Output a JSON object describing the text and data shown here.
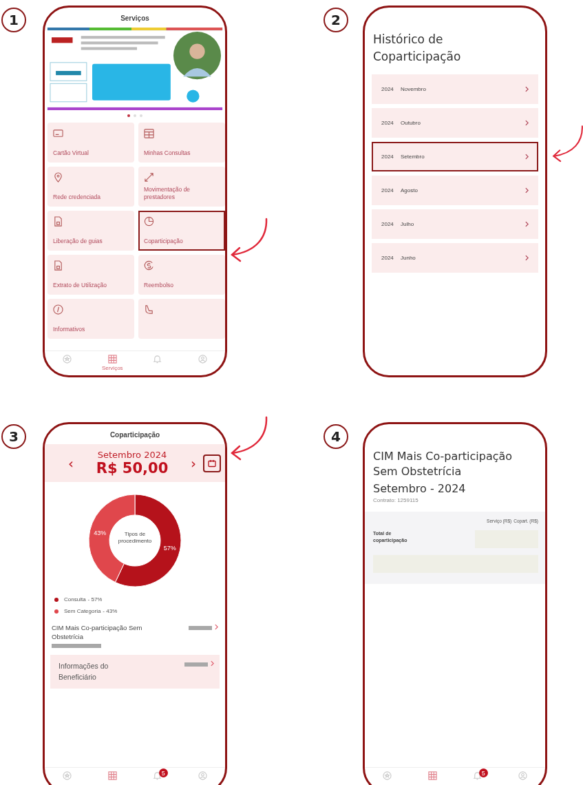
{
  "steps": [
    {
      "number": "1",
      "kind": "services",
      "arrow": true,
      "screen": {
        "title": "Serviços",
        "carousel": [
          {
            "selected": true
          },
          {
            "selected": false
          },
          {
            "selected": false
          }
        ],
        "tiles_left": [
          {
            "label": "Cartão Virtual",
            "highlighted": false
          },
          {
            "label": "Rede credenciada",
            "highlighted": false
          },
          {
            "label": "Liberação de guias",
            "highlighted": false
          },
          {
            "label": "Extrato de Utilização",
            "highlighted": false
          },
          {
            "label": "Informativos",
            "highlighted": false
          }
        ],
        "tiles_right": [
          {
            "label": "Minhas Consultas",
            "highlighted": false
          },
          {
            "label": "Movimentação de prestadores",
            "highlighted": false
          },
          {
            "label": "Coparticipação",
            "highlighted": true
          },
          {
            "label": "Reembolso",
            "highlighted": false
          },
          {
            "highlighted": false
          }
        ],
        "tab_bar": [
          {
            "selected": false
          },
          {
            "label": "Serviços",
            "selected": true
          },
          {
            "selected": false
          },
          {
            "selected": false
          }
        ]
      }
    },
    {
      "number": "2",
      "kind": "history",
      "arrow": true,
      "screen": {
        "title": "Histórico de Coparticipação",
        "months": [
          {
            "year": "2024",
            "month": "Novembro",
            "highlighted": false
          },
          {
            "year": "2024",
            "month": "Outubro",
            "highlighted": false
          },
          {
            "year": "2024",
            "month": "Setembro",
            "highlighted": true
          },
          {
            "year": "2024",
            "month": "Agosto",
            "highlighted": false
          },
          {
            "year": "2024",
            "month": "Julho",
            "highlighted": false
          },
          {
            "year": "2024",
            "month": "Junho",
            "highlighted": false
          }
        ]
      }
    },
    {
      "number": "3",
      "kind": "summary",
      "arrow": true,
      "screen": {
        "title": "Coparticipação",
        "prev": "‹",
        "period": "Setembro 2024",
        "amount": "R$ 50,00",
        "next": "›",
        "calendar_highlighted": true,
        "chart_data": {
          "type": "donut",
          "categories": [
            "Consulta",
            "Sem Categoria"
          ],
          "series": [
            {
              "name": "Tipos de procedimento",
              "values": [
                57,
                43
              ]
            }
          ],
          "value_labels": [
            "57%",
            "43%"
          ]
        },
        "legend": [
          {
            "value_text": "- 57%",
            "color": "#b5121b"
          },
          {
            "value_text": "- 43%",
            "color": "#e0474c"
          }
        ],
        "plan": "CIM Mais Co-participação Sem Obstetrícia",
        "beneficiary": "Informações do Beneficiário",
        "tab_bar": [
          {
            "selected": false
          },
          {
            "selected": true
          },
          {
            "selected": false,
            "badge": "5"
          },
          {
            "selected": false
          }
        ]
      }
    },
    {
      "number": "4",
      "kind": "statement",
      "screen": {
        "title": "CIM Mais Co-participação Sem Obstetrícia",
        "period": "Setembro - 2024",
        "contract": "Contrato: 1259115",
        "columns": [
          "Serviço (R$)",
          "Copart. (R$)"
        ],
        "total_label": "Total de coparticipação",
        "tab_bar": [
          {
            "selected": false
          },
          {
            "selected": true
          },
          {
            "selected": false,
            "badge": "5"
          },
          {
            "selected": false
          }
        ]
      }
    }
  ]
}
